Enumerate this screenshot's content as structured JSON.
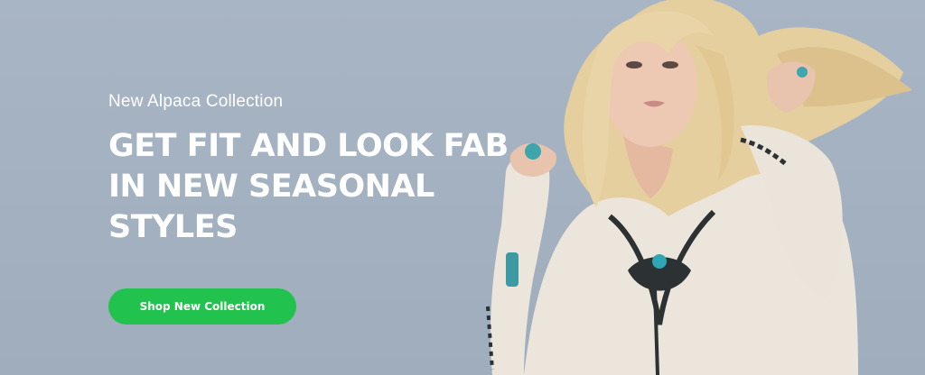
{
  "hero": {
    "kicker": "New Alpaca Collection",
    "headline": "GET FIT AND LOOK FAB IN NEW SEASONAL STYLES",
    "cta_label": "Shop New Collection"
  },
  "colors": {
    "background": "#a3b1c0",
    "cta": "#21c24d",
    "text": "#ffffff"
  },
  "image": {
    "subject": "model-photo"
  }
}
